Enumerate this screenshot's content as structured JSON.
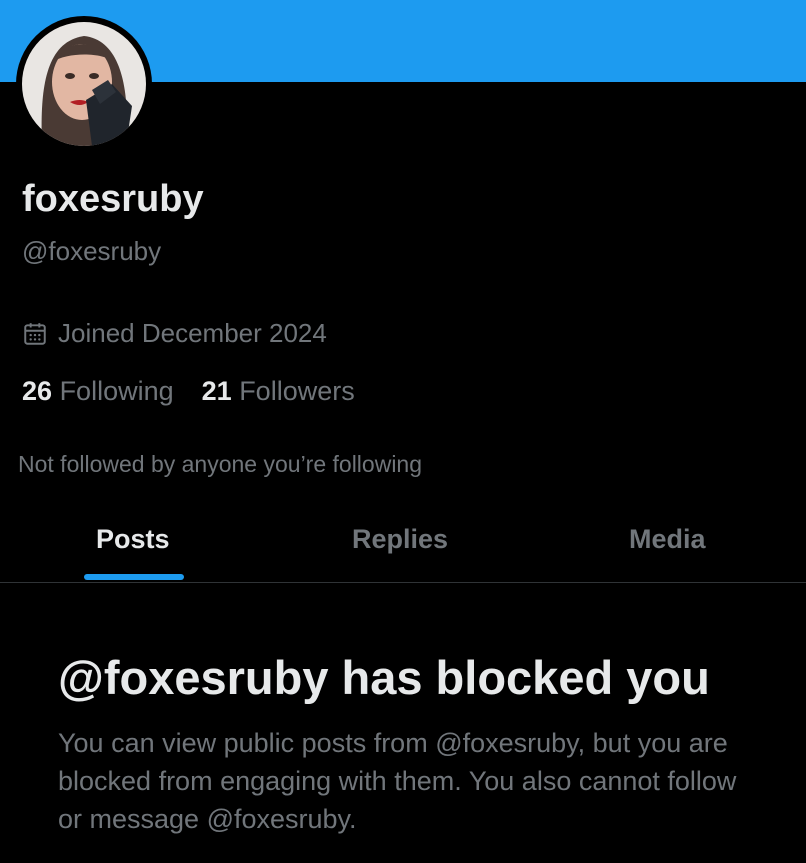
{
  "profile": {
    "display_name": "foxesruby",
    "handle": "@foxesruby",
    "joined": "Joined December 2024",
    "following_count": "26",
    "following_label": "Following",
    "followers_count": "21",
    "followers_label": "Followers",
    "not_followed_text": "Not followed by anyone you’re following"
  },
  "tabs": [
    {
      "label": "Posts",
      "active": true
    },
    {
      "label": "Replies",
      "active": false
    },
    {
      "label": "Media",
      "active": false
    }
  ],
  "blocked": {
    "title": "@foxesruby has blocked you",
    "body": "You can view public posts from @foxesruby, but you are blocked from engaging with them. You also cannot follow or message @foxesruby."
  },
  "icons": {
    "calendar": "calendar-icon"
  },
  "colors": {
    "banner": "#1d9bf0",
    "accent": "#1d9bf0",
    "background": "#000000",
    "primary_text": "#e7e9ea",
    "secondary_text": "#71767b"
  }
}
